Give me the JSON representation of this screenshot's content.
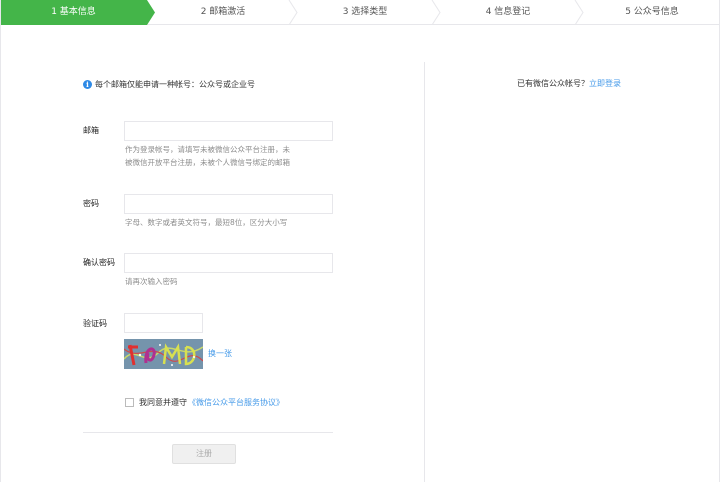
{
  "steps": [
    {
      "label": "1 基本信息",
      "active": true
    },
    {
      "label": "2 邮箱激活",
      "active": false
    },
    {
      "label": "3 选择类型",
      "active": false
    },
    {
      "label": "4 信息登记",
      "active": false
    },
    {
      "label": "5 公众号信息",
      "active": false
    }
  ],
  "notice": {
    "icon_text": "i",
    "text": "每个邮箱仅能申请一种帐号：公众号或企业号"
  },
  "login_hint": {
    "text": "已有微信公众帐号？",
    "link": "立即登录"
  },
  "form": {
    "email": {
      "label": "邮箱",
      "value": "",
      "hint_line1": "作为登录帐号，请填写未被微信公众平台注册，未",
      "hint_line2": "被微信开放平台注册，未被个人微信号绑定的邮箱"
    },
    "password": {
      "label": "密码",
      "value": "",
      "hint": "字母、数字或者英文符号，最短8位，区分大小写"
    },
    "confirm": {
      "label": "确认密码",
      "value": "",
      "hint": "请再次输入密码"
    },
    "captcha": {
      "label": "验证码",
      "value": "",
      "refresh": "换一张"
    },
    "agree": {
      "text": "我同意并遵守",
      "link": "《微信公众平台服务协议》"
    },
    "submit": "注册"
  },
  "colors": {
    "accent": "#44b549",
    "link": "#459ae9"
  }
}
